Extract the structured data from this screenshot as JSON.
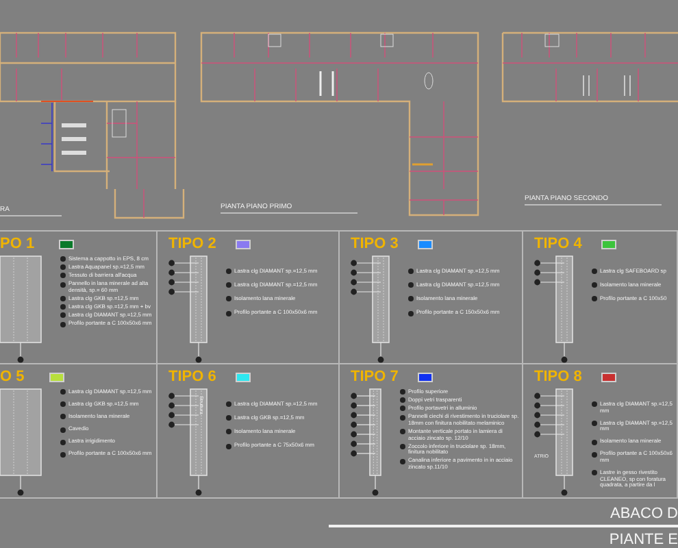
{
  "plans": [
    {
      "label": "RA"
    },
    {
      "label": "PIANTA PIANO PRIMO"
    },
    {
      "label": "PIANTA PIANO SECONDO"
    }
  ],
  "types": [
    {
      "title": "PO 1",
      "color": "#0a7a2a",
      "legend": [
        {
          "text": "Sistema a cappotto in EPS, 8 cm"
        },
        {
          "text": "Lastra Aquapanel sp.=12,5 mm"
        },
        {
          "text": "Tessuto di barriera all'acqua"
        },
        {
          "text": "Pannello in lana minerale ad alta densità, sp.= 60 mm"
        },
        {
          "text": "Lastra clg GKB sp.=12,5 mm"
        },
        {
          "text": "Lastra clg GKB sp.=12,5 mm + bv"
        },
        {
          "text": "Lastra clg DIAMANT sp.=12,5 mm"
        },
        {
          "text": "Profilo portante a C 100x50x6 mm"
        }
      ]
    },
    {
      "title": "TIPO 2",
      "color": "#8a7af0",
      "legend": [
        {
          "text": "Lastra clg DIAMANT sp.=12,5 mm"
        },
        {
          "text": "Lastra clg DIAMANT sp.=12,5 mm"
        },
        {
          "text": "Isolamento lana minerale"
        },
        {
          "text": "Profilo portante a C 100x50x6 mm"
        }
      ]
    },
    {
      "title": "TIPO 3",
      "color": "#1a8cff",
      "legend": [
        {
          "text": "Lastra clg DIAMANT sp.=12,5 mm"
        },
        {
          "text": "Lastra clg DIAMANT sp.=12,5 mm"
        },
        {
          "text": "Isolamento lana minerale"
        },
        {
          "text": "Profilo portante a C 150x50x6 mm"
        }
      ]
    },
    {
      "title": "TIPO 4",
      "color": "#3cc43c",
      "legend": [
        {
          "text": "Lastra clg SAFEBOARD sp"
        },
        {
          "text": "Isolamento lana minerale"
        },
        {
          "text": "Profilo portante a C 100x50"
        }
      ]
    },
    {
      "title": "O 5",
      "color": "#b8e03c",
      "legend": [
        {
          "text": "Lastra clg DIAMANT sp.=12,5 mm"
        },
        {
          "text": "Lastra clg GKB sp.=12,5 mm"
        },
        {
          "text": "Isolamento lana minerale"
        },
        {
          "text": "Cavedio"
        },
        {
          "text": "Lastra irrigidimento"
        },
        {
          "text": "Profilo portante a C 100x50x6 mm"
        }
      ]
    },
    {
      "title": "TIPO 6",
      "color": "#2ee8f0",
      "drawing_label": "Struttura",
      "legend": [
        {
          "text": "Lastra clg DIAMANT sp.=12,5 mm"
        },
        {
          "text": "Lastra clg GKB sp.=12,5 mm"
        },
        {
          "text": "Isolamento lana minerale"
        },
        {
          "text": "Profilo portante a C 75x50x6 mm"
        }
      ]
    },
    {
      "title": "TIPO 7",
      "color": "#1030f0",
      "legend": [
        {
          "text": "Profilo superiore"
        },
        {
          "text": "Doppi vetri trasparenti"
        },
        {
          "text": "Profilo portavetri in alluminio"
        },
        {
          "text": "Pannelli ciechi di rivestimento in truciolare sp. 18mm con finitura nobilitato melaminico"
        },
        {
          "text": "Montante verticale portato in lamiera di acciaio zincato sp. 12/10"
        },
        {
          "text": "Zoccolo inferiore in truciolare sp. 18mm, finitura nobilitato"
        },
        {
          "text": "Canalina inferiore a pavimento in in acciaio zincato sp.11/10"
        }
      ]
    },
    {
      "title": "TIPO 8",
      "color": "#c83030",
      "drawing_label": "ATRIO",
      "legend": [
        {
          "text": "Lastra clg DIAMANT sp.=12,5 mm"
        },
        {
          "text": "Lastra clg DIAMANT sp.=12,5 mm"
        },
        {
          "text": "Isolamento lana minerale"
        },
        {
          "text": "Profilo portante a C 100x50x6 mm"
        },
        {
          "text": "Lastre in gesso rivestito CLEANEO, sp con foratura quadrata, a partire da l"
        }
      ]
    }
  ],
  "title_block": {
    "title": "ABACO D",
    "subtitle": "PIANTE E"
  }
}
